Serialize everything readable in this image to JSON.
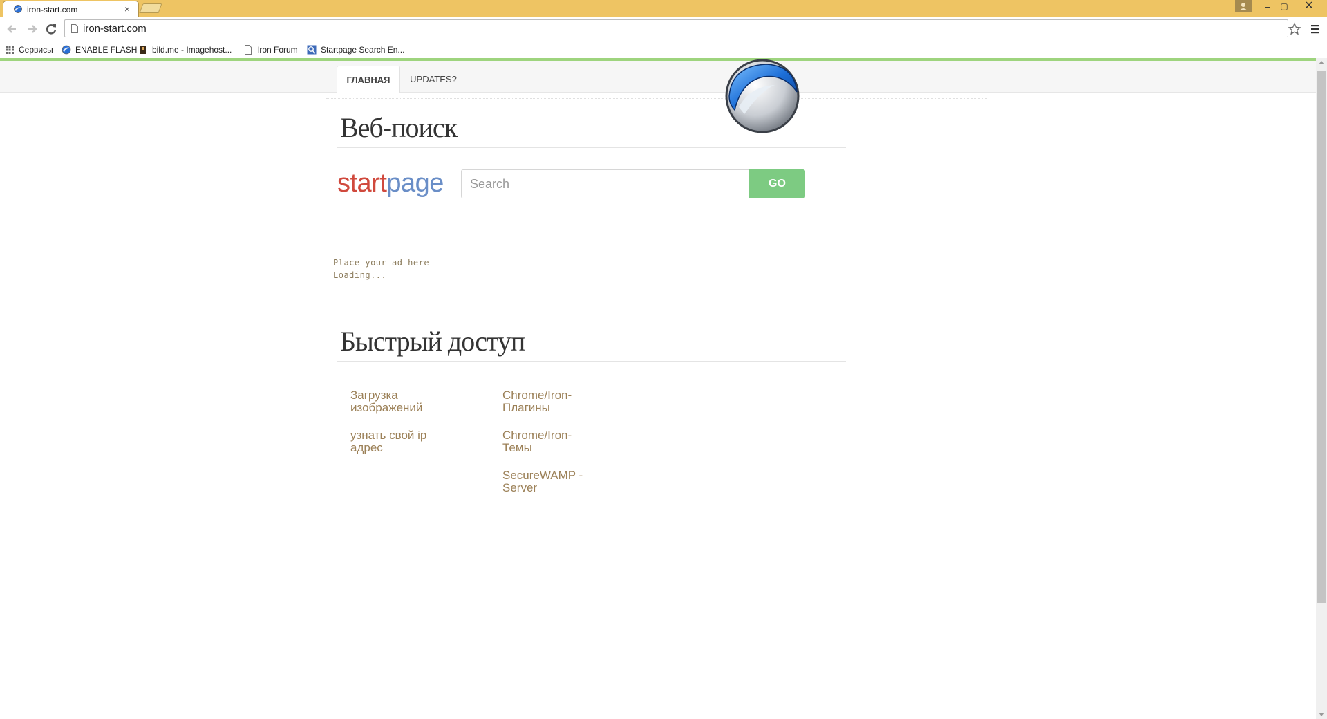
{
  "browser": {
    "tab_title": "iron-start.com",
    "tab_close": "×",
    "url": "iron-start.com",
    "bookmarks": {
      "apps": "Сервисы",
      "flash": "ENABLE FLASH",
      "bild": "bild.me - Imagehost...",
      "iron": "Iron Forum",
      "startpage": "Startpage Search En..."
    },
    "controls": {
      "minimize": "–",
      "maximize": "▢",
      "close": "✕"
    },
    "chrome_color": "#eec463"
  },
  "page": {
    "nav": {
      "home": "ГЛАВНАЯ",
      "updates": "UPDATES?"
    },
    "web_search_title": "Веб-поиск",
    "startpage_logo": {
      "start": "start",
      "page": "page"
    },
    "search": {
      "placeholder": "Search",
      "go_label": "GO"
    },
    "ad": {
      "line1": "Place your ad here",
      "line2": "Loading..."
    },
    "quick_access_title": "Быстрый доступ",
    "quick_links": [
      "Загрузка изображений",
      "узнать свой ip адрес",
      "Chrome/Iron-Плагины",
      "Chrome/Iron-Темы",
      "SecureWAMP - Server"
    ],
    "colors": {
      "accent_green": "#7dcb82",
      "link_color": "#9c8158",
      "top_line": "#9ed47e"
    }
  }
}
